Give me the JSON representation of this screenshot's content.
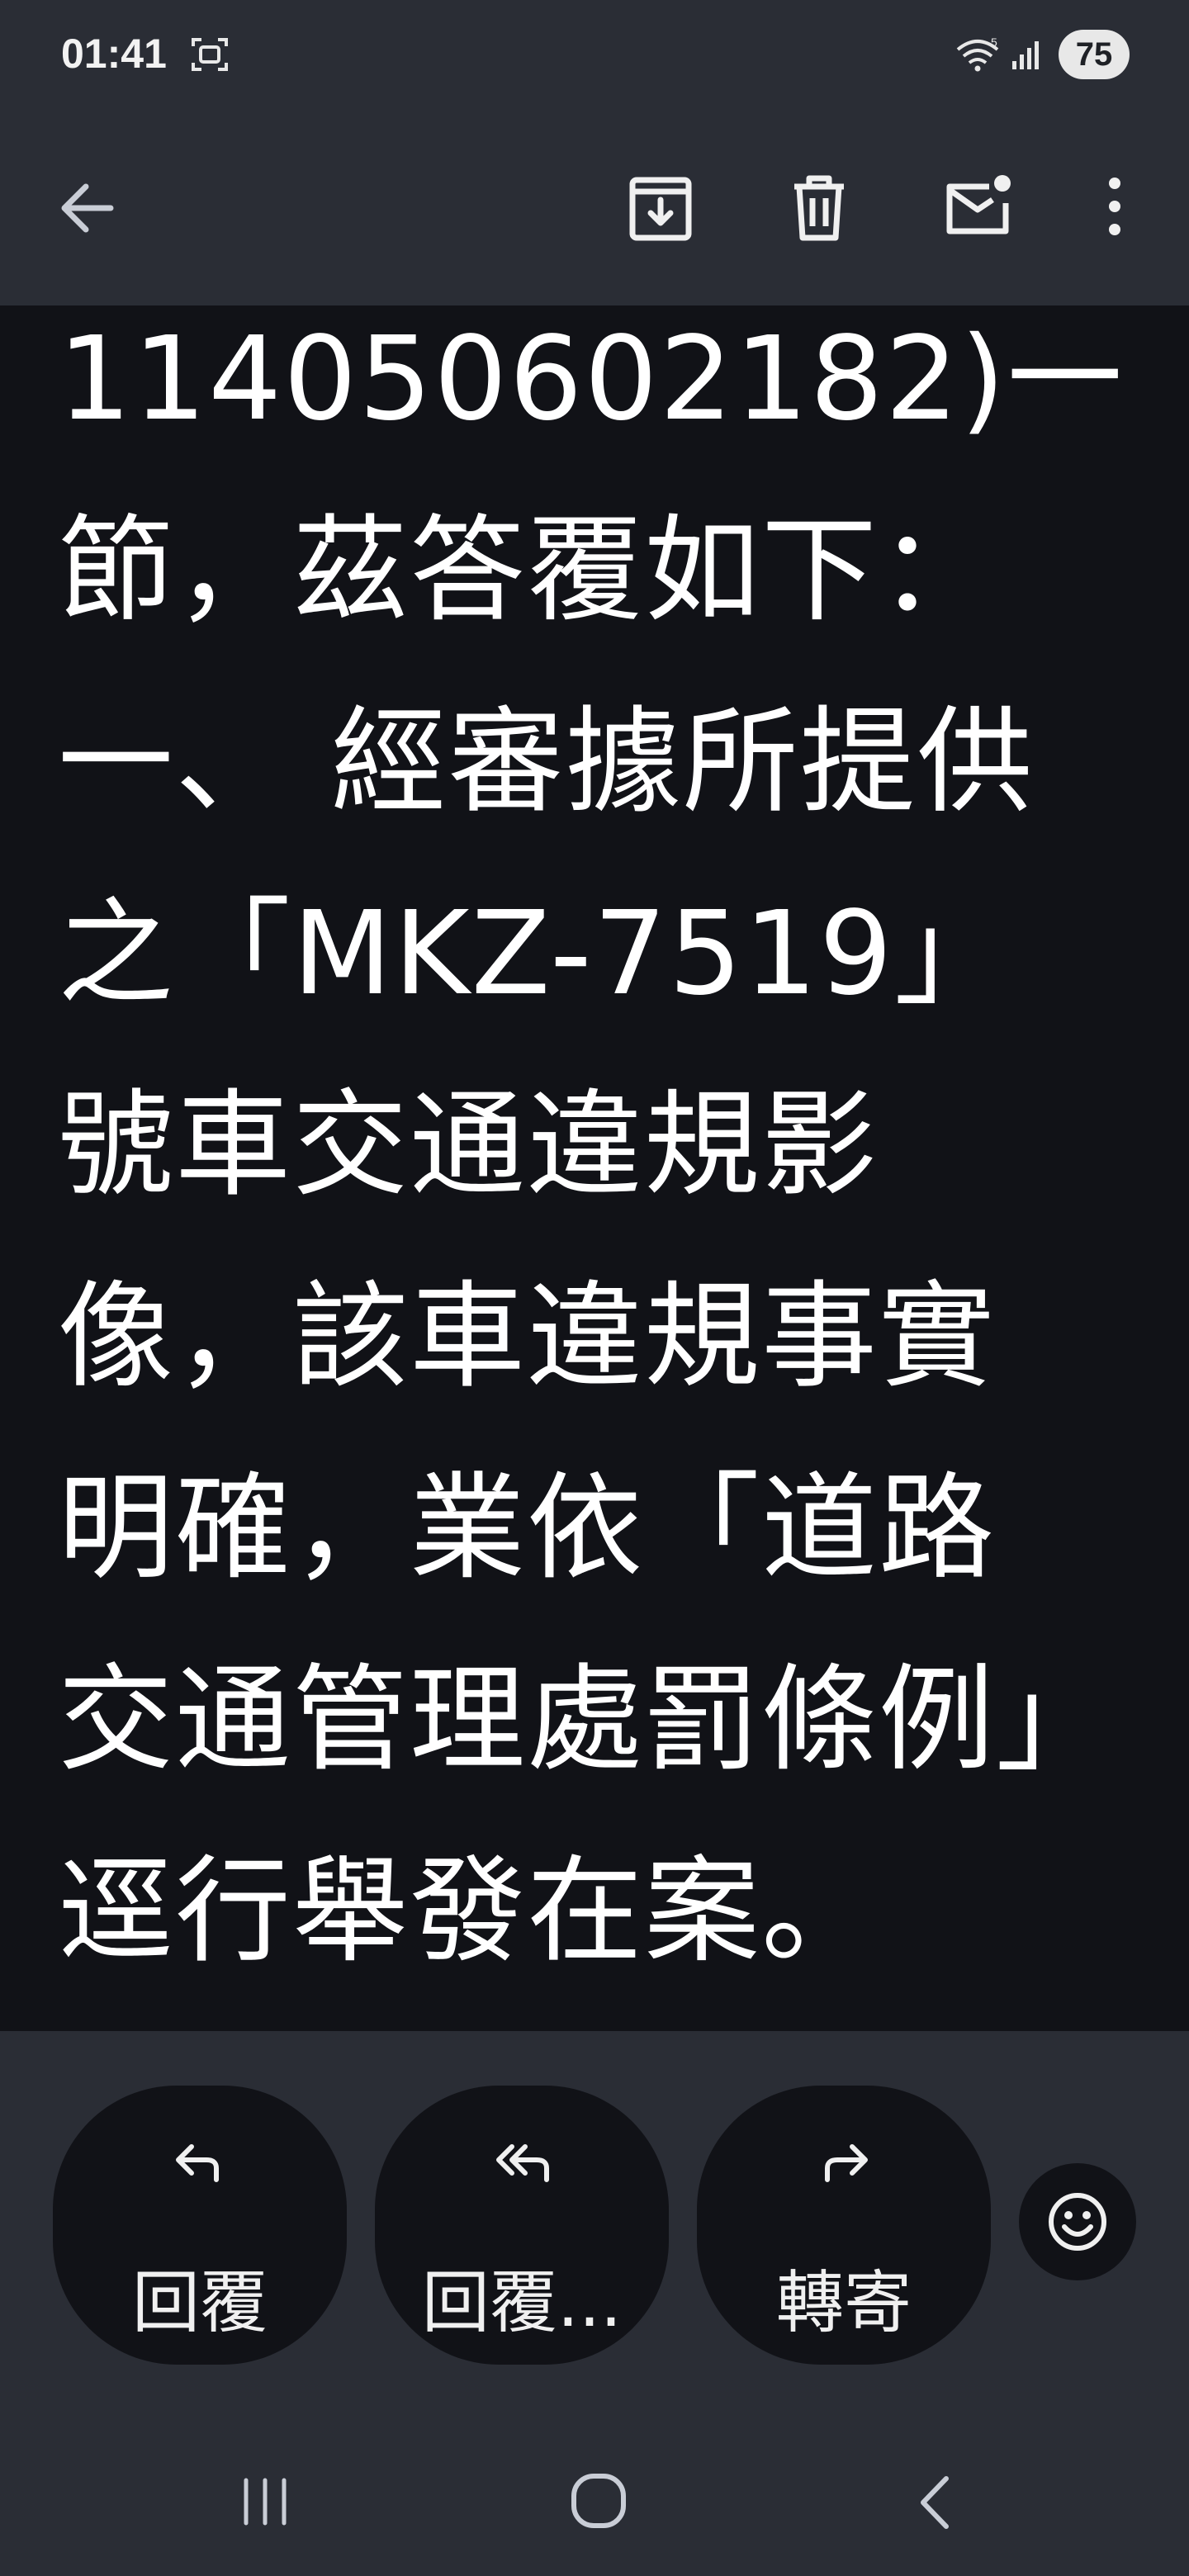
{
  "status_bar": {
    "time": "01:41",
    "battery": "75",
    "wifi_badge": "5"
  },
  "app_bar": {
    "back_icon": "arrow-left-icon",
    "actions": [
      "archive-icon",
      "trash-icon",
      "mark-unread-icon",
      "more-vert-icon"
    ]
  },
  "message": {
    "lines": [
      "114050602182)一",
      "節，茲答覆如下：",
      "一、 經審據所提供",
      "之「MKZ-7519」",
      "號車交通違規影",
      "像，該車違規事實",
      "明確，業依「道路",
      "交通管理處罰條例」",
      "逕行舉發在案。"
    ]
  },
  "actions": {
    "reply_label": "回覆",
    "reply_all_label": "回覆...",
    "forward_label": "轉寄",
    "emoji_icon": "emoji-icon"
  },
  "colors": {
    "chrome": "#2a2d35",
    "body_bg": "#111217",
    "text": "#ffffff"
  }
}
